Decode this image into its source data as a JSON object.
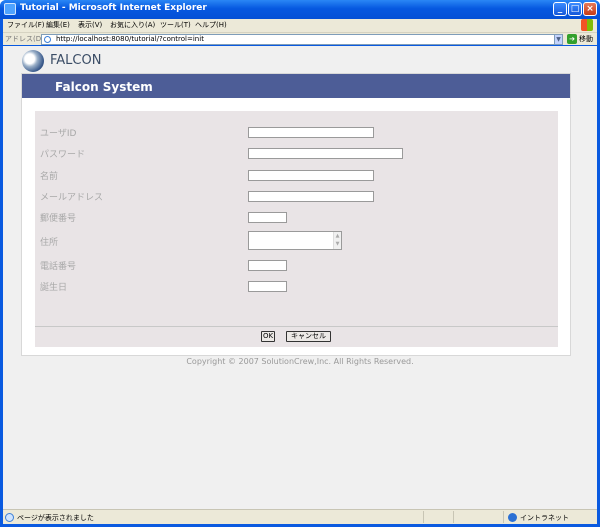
{
  "window": {
    "title": "Tutorial - Microsoft Internet Explorer",
    "controls": {
      "minimize": "_",
      "maximize": "□",
      "close": "×"
    }
  },
  "menu": [
    "ファイル(F)",
    "編集(E)",
    "表示(V)",
    "お気に入り(A)",
    "ツール(T)",
    "ヘルプ(H)"
  ],
  "address": {
    "label": "アドレス(D)",
    "url": "http://localhost:8080/tutorial/?control=init",
    "go_label": "移動"
  },
  "page": {
    "logo": "FALCON",
    "header": "Falcon System",
    "fields": [
      {
        "label": "ユーザID",
        "value": ""
      },
      {
        "label": "パスワード",
        "value": ""
      },
      {
        "label": "名前",
        "value": ""
      },
      {
        "label": "メールアドレス",
        "value": ""
      },
      {
        "label": "郵便番号",
        "value": ""
      },
      {
        "label": "住所",
        "value": ""
      },
      {
        "label": "電話番号",
        "value": ""
      },
      {
        "label": "誕生日",
        "value": ""
      }
    ],
    "ok_button": "OK",
    "cancel_button": "キャンセル",
    "copyright": "Copyright © 2007 SolutionCrew,Inc. All Rights Reserved."
  },
  "status": {
    "text": "ページが表示されました",
    "zone": "イントラネット"
  }
}
